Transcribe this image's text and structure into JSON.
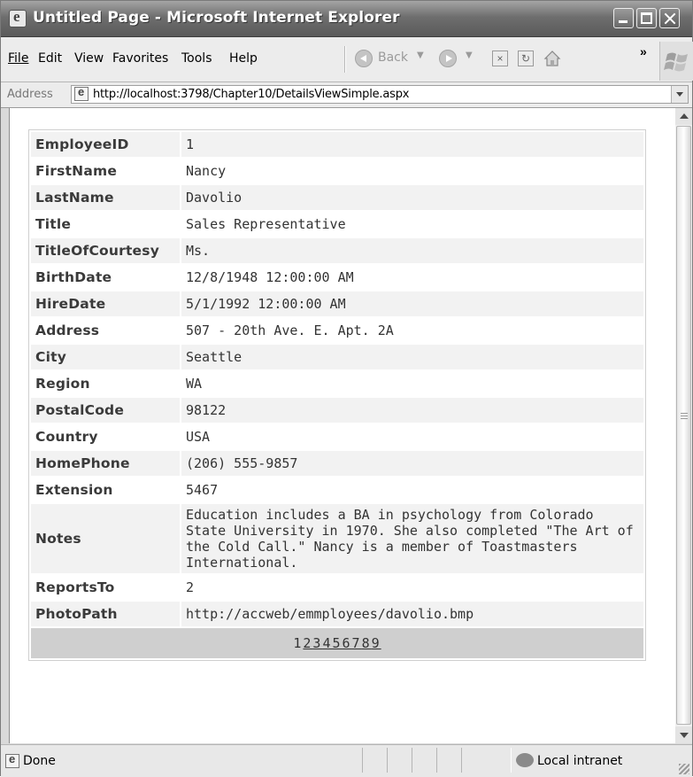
{
  "window": {
    "title": "Untitled Page - Microsoft Internet Explorer"
  },
  "menu": {
    "items": [
      {
        "label": "File"
      },
      {
        "label": "Edit"
      },
      {
        "label": "View"
      },
      {
        "label": "Favorites"
      },
      {
        "label": "Tools"
      },
      {
        "label": "Help"
      }
    ],
    "back_label": "Back",
    "more": "»"
  },
  "address": {
    "label": "Address",
    "url": "http://localhost:3798/Chapter10/DetailsViewSimple.aspx"
  },
  "details": {
    "rows": [
      {
        "field": "EmployeeID",
        "value": "1"
      },
      {
        "field": "FirstName",
        "value": "Nancy"
      },
      {
        "field": "LastName",
        "value": "Davolio"
      },
      {
        "field": "Title",
        "value": "Sales Representative"
      },
      {
        "field": "TitleOfCourtesy",
        "value": "Ms."
      },
      {
        "field": "BirthDate",
        "value": "12/8/1948 12:00:00 AM"
      },
      {
        "field": "HireDate",
        "value": "5/1/1992 12:00:00 AM"
      },
      {
        "field": "Address",
        "value": "507 - 20th Ave. E. Apt. 2A"
      },
      {
        "field": "City",
        "value": "Seattle"
      },
      {
        "field": "Region",
        "value": "WA"
      },
      {
        "field": "PostalCode",
        "value": "98122"
      },
      {
        "field": "Country",
        "value": "USA"
      },
      {
        "field": "HomePhone",
        "value": "(206) 555-9857"
      },
      {
        "field": "Extension",
        "value": "5467"
      },
      {
        "field": "Notes",
        "value": "Education includes a BA in psychology from Colorado State University in 1970. She also completed \"The Art of the Cold Call.\" Nancy is a member of Toastmasters International."
      },
      {
        "field": "ReportsTo",
        "value": "2"
      },
      {
        "field": "PhotoPath",
        "value": "http://accweb/emmployees/davolio.bmp"
      }
    ],
    "pager": {
      "current": "1",
      "pages": [
        "2",
        "3",
        "4",
        "5",
        "6",
        "7",
        "8",
        "9"
      ]
    }
  },
  "status": {
    "text": "Done",
    "zone": "Local intranet"
  },
  "colors": {
    "title_bar": "#6e6e6e",
    "alt_row": "#f2f2f2",
    "pager_bg": "#cfcfcf"
  }
}
